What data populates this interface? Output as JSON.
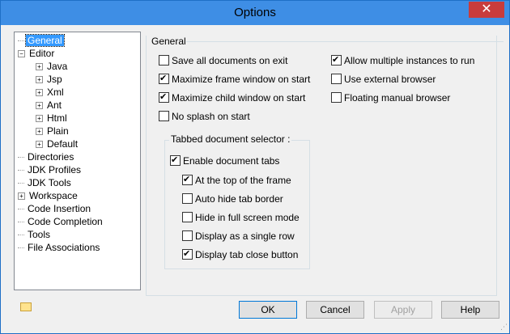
{
  "window": {
    "title": "Options",
    "close_glyph": "✕"
  },
  "tree": {
    "items": [
      {
        "label": "General",
        "selected": true
      },
      {
        "label": "Editor",
        "expander": "−"
      },
      {
        "label": "Java",
        "expander": "+"
      },
      {
        "label": "Jsp",
        "expander": "+"
      },
      {
        "label": "Xml",
        "expander": "+"
      },
      {
        "label": "Ant",
        "expander": "+"
      },
      {
        "label": "Html",
        "expander": "+"
      },
      {
        "label": "Plain",
        "expander": "+"
      },
      {
        "label": "Default",
        "expander": "+"
      },
      {
        "label": "Directories"
      },
      {
        "label": "JDK Profiles"
      },
      {
        "label": "JDK Tools"
      },
      {
        "label": "Workspace",
        "expander": "+"
      },
      {
        "label": "Code Insertion"
      },
      {
        "label": "Code Completion"
      },
      {
        "label": "Tools"
      },
      {
        "label": "File Associations"
      }
    ]
  },
  "general": {
    "label": "General",
    "left_options": [
      {
        "label": "Save all documents on exit",
        "checked": false
      },
      {
        "label": "Maximize frame window on start",
        "checked": true
      },
      {
        "label": "Maximize child window on start",
        "checked": true
      },
      {
        "label": "No splash on start",
        "checked": false
      }
    ],
    "right_options": [
      {
        "label": "Allow multiple instances to run",
        "checked": true
      },
      {
        "label": "Use external browser",
        "checked": false
      },
      {
        "label": "Floating manual browser",
        "checked": false
      }
    ]
  },
  "tabbed": {
    "label": "Tabbed document selector :",
    "enable": {
      "label": "Enable document tabs",
      "checked": true
    },
    "options": [
      {
        "label": "At the top of the frame",
        "checked": true
      },
      {
        "label": "Auto hide tab border",
        "checked": false
      },
      {
        "label": "Hide in full screen mode",
        "checked": false
      },
      {
        "label": "Display as a single row",
        "checked": false
      },
      {
        "label": "Display tab close button",
        "checked": true
      }
    ]
  },
  "buttons": {
    "ok": "OK",
    "cancel": "Cancel",
    "apply": "Apply",
    "help": "Help"
  }
}
